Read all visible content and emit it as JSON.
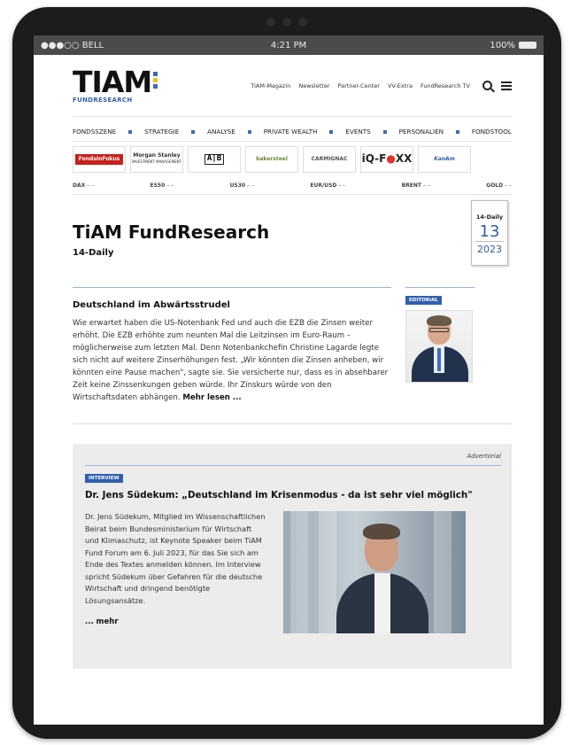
{
  "status_bar": {
    "carrier": "●●●○○ BELL",
    "time": "4:21 PM",
    "battery": "100%"
  },
  "header": {
    "logo": "TIAM",
    "logo_sub": "FUNDRESEARCH",
    "links": [
      "TiAM-Magazin",
      "Newsletter",
      "Partner-Center",
      "VV-Extra",
      "FundResearch TV"
    ]
  },
  "categories": [
    "FONDSSZENE",
    "STRATEGIE",
    "ANALYSE",
    "PRIVATE WEALTH",
    "EVENTS",
    "PERSONALIEN",
    "FONDSTOOL"
  ],
  "partners": {
    "fondsfokus": "FondsInFokus",
    "morgan": "Morgan Stanley",
    "morgan_sub": "INVESTMENT MANAGEMENT",
    "ab": "A|B",
    "baker": "bakersteel",
    "carmignac": "CARMIGNAC",
    "iqfoxx_a": "iQ-F",
    "iqfoxx_b": "XX",
    "kanam": "KanAm"
  },
  "tickers": [
    {
      "name": "DAX",
      "value": "– –"
    },
    {
      "name": "ES50",
      "value": "– –"
    },
    {
      "name": "US30",
      "value": "– –"
    },
    {
      "name": "EUR/USD",
      "value": "– –"
    },
    {
      "name": "BRENT",
      "value": "– –"
    },
    {
      "name": "GOLD",
      "value": "– –"
    }
  ],
  "title": {
    "main": "TiAM FundResearch",
    "sub": "14-Daily"
  },
  "datebox": {
    "label": "14-Daily",
    "day": "13",
    "year": "2023"
  },
  "editorial": {
    "badge": "EDITORIAL",
    "title": "Deutschland im Abwärtsstrudel",
    "text": "Wie erwartet haben die US-Notenbank Fed und auch die EZB die Zinsen weiter erhöht. Die EZB erhöhte zum neunten Mal die Leitzinsen im Euro-Raum – möglicherweise zum letzten Mal. Denn Notenbankchefin Christine Lagarde legte sich nicht auf weitere Zinserhöhungen fest. „Wir könnten die Zinsen anheben, wir könnten eine Pause machen\", sagte sie. Sie versicherte nur, dass es in absehbarer Zeit keine Zinssenkungen geben würde. Ihr Zinskurs würde von den Wirtschaftsdaten abhängen.",
    "more": "Mehr lesen ..."
  },
  "advertorial": {
    "label": "Advertorial",
    "badge": "INTERVIEW",
    "title": "Dr. Jens Südekum: „Deutschland im Krisenmodus - da ist sehr viel möglich\"",
    "text": "Dr. Jens Südekum, Mitglied im Wissenschaftlichen Beirat beim Bundesministerium für Wirtschaft und Klimaschutz, ist Keynote Speaker beim TiAM Fund Forum am 6. Juli 2023, für das Sie sich am Ende des Textes anmelden können. Im Interview spricht Südekum über Gefahren für die deutsche Wirtschaft und dringend benötigte Lösungsansätze.",
    "more": "... mehr"
  }
}
